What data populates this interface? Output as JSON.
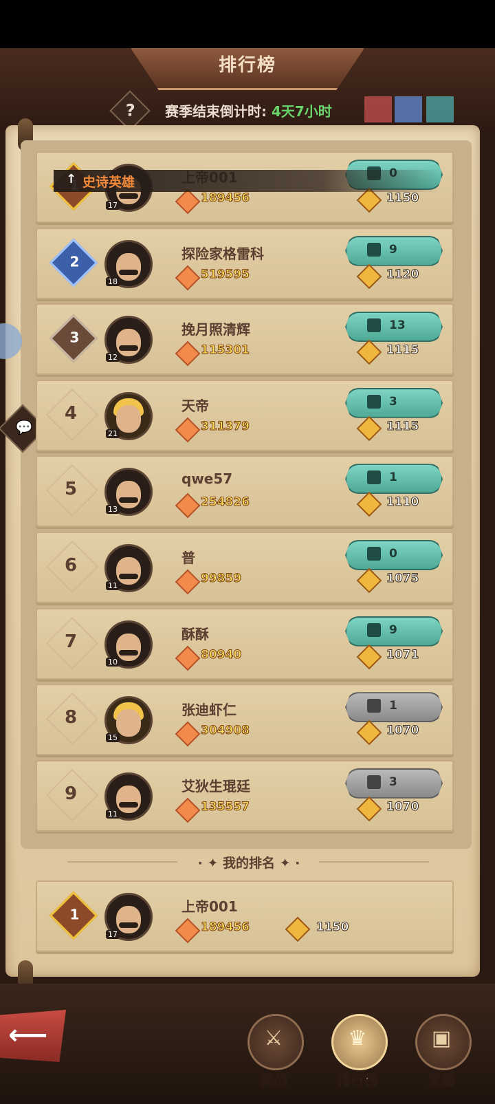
{
  "header": {
    "title": "排行榜",
    "countdown_label": "赛季结束倒计时:",
    "countdown_value": "4天7小时",
    "help_icon": "?"
  },
  "epic_banner": {
    "text": "史诗英雄"
  },
  "rows": [
    {
      "rank": "1",
      "name": "上帝001",
      "power": "189456",
      "likes": "0",
      "trophies": "1150",
      "level": "17",
      "avatar": "dark",
      "like_style": "teal",
      "rank_color": "#8c4a2a"
    },
    {
      "rank": "2",
      "name": "探险家格雷科",
      "power": "519595",
      "likes": "9",
      "trophies": "1120",
      "level": "18",
      "avatar": "dark",
      "like_style": "teal",
      "rank_color": "#3b5fa8"
    },
    {
      "rank": "3",
      "name": "挽月照清辉",
      "power": "115301",
      "likes": "13",
      "trophies": "1115",
      "level": "12",
      "avatar": "dark",
      "like_style": "teal",
      "rank_color": "#6a4b3a"
    },
    {
      "rank": "4",
      "name": "天帝",
      "power": "311379",
      "likes": "3",
      "trophies": "1115",
      "level": "21",
      "avatar": "blonde",
      "like_style": "teal"
    },
    {
      "rank": "5",
      "name": "qwe57",
      "power": "254826",
      "likes": "1",
      "trophies": "1110",
      "level": "13",
      "avatar": "dark",
      "like_style": "teal"
    },
    {
      "rank": "6",
      "name": "普",
      "power": "99859",
      "likes": "0",
      "trophies": "1075",
      "level": "11",
      "avatar": "dark",
      "like_style": "teal"
    },
    {
      "rank": "7",
      "name": "酥酥",
      "power": "80940",
      "likes": "9",
      "trophies": "1071",
      "level": "10",
      "avatar": "dark",
      "like_style": "teal"
    },
    {
      "rank": "8",
      "name": "张迪虾仁",
      "power": "304908",
      "likes": "1",
      "trophies": "1070",
      "level": "15",
      "avatar": "blonde",
      "like_style": "grey"
    },
    {
      "rank": "9",
      "name": "艾狄生琨廷",
      "power": "135557",
      "likes": "3",
      "trophies": "1070",
      "level": "11",
      "avatar": "dark",
      "like_style": "grey"
    }
  ],
  "my_rank": {
    "section_title": "我的排名",
    "rank": "1",
    "name": "上帝001",
    "power": "189456",
    "trophies": "1150",
    "level": "17"
  },
  "bottom_nav": {
    "back_icon": "back-arrow-icon",
    "tabs": [
      {
        "label": "挑战",
        "icon": "crossed-swords-icon",
        "active": false
      },
      {
        "label": "排行榜",
        "icon": "crown-icon",
        "active": true
      },
      {
        "label": "奖励",
        "icon": "chest-icon",
        "active": false
      }
    ]
  },
  "colors": {
    "accent_green": "#67d36a",
    "like_teal": "#4fa996",
    "epic_orange": "#f08a3a"
  }
}
